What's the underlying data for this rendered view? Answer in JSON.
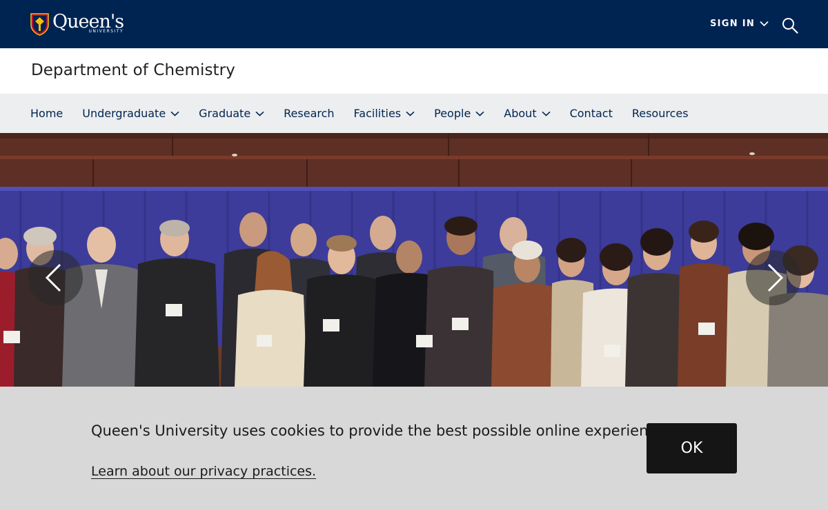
{
  "brand": {
    "wordmark": "Queen's",
    "sub": "UNIVERSITY",
    "color_navy": "#002452",
    "color_red": "#b90e31",
    "color_gold": "#fabd0f"
  },
  "header": {
    "signin_label": "SIGN IN",
    "search_icon": "search-icon"
  },
  "department": {
    "title": "Department of Chemistry"
  },
  "nav": {
    "items": [
      {
        "label": "Home",
        "has_dropdown": false
      },
      {
        "label": "Undergraduate",
        "has_dropdown": true
      },
      {
        "label": "Graduate",
        "has_dropdown": true
      },
      {
        "label": "Research",
        "has_dropdown": false
      },
      {
        "label": "Facilities",
        "has_dropdown": true
      },
      {
        "label": "People",
        "has_dropdown": true
      },
      {
        "label": "About",
        "has_dropdown": true
      },
      {
        "label": "Contact",
        "has_dropdown": false
      },
      {
        "label": "Resources",
        "has_dropdown": false
      }
    ]
  },
  "hero": {
    "prev_icon": "chevron-left-icon",
    "next_icon": "chevron-right-icon"
  },
  "cookie": {
    "message": "Queen's University uses cookies to provide the best possible online experience.",
    "link_label": "Learn about our privacy practices.",
    "ok_label": "OK"
  }
}
